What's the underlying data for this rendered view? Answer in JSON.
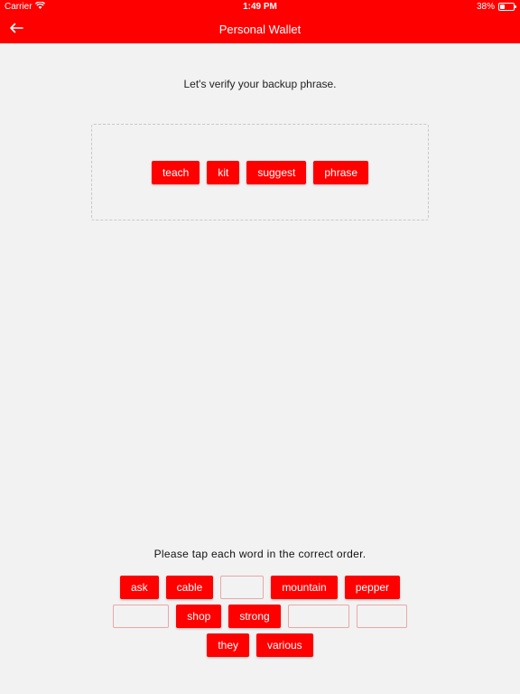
{
  "status_bar": {
    "carrier": "Carrier",
    "time": "1:49 PM",
    "battery": "38%",
    "battery_level": 0.38
  },
  "header": {
    "title": "Personal Wallet",
    "back_icon": "arrow-left-icon",
    "bg_color": "#ff0000"
  },
  "verify": {
    "prompt": "Let's verify your backup phrase.",
    "selected_words": [
      "teach",
      "kit",
      "suggest",
      "phrase"
    ]
  },
  "word_bank": {
    "instruction": "Please tap each word in the correct order.",
    "row1": [
      {
        "word": "ask",
        "used": false
      },
      {
        "word": "cable",
        "used": false
      },
      {
        "word": "",
        "used": true
      },
      {
        "word": "mountain",
        "used": false
      },
      {
        "word": "pepper",
        "used": false
      }
    ],
    "row2": [
      {
        "word": "",
        "used": true
      },
      {
        "word": "shop",
        "used": false
      },
      {
        "word": "strong",
        "used": false
      },
      {
        "word": "",
        "used": true
      },
      {
        "word": "",
        "used": true
      }
    ],
    "row3": [
      {
        "word": "they",
        "used": false
      },
      {
        "word": "various",
        "used": false
      }
    ]
  }
}
